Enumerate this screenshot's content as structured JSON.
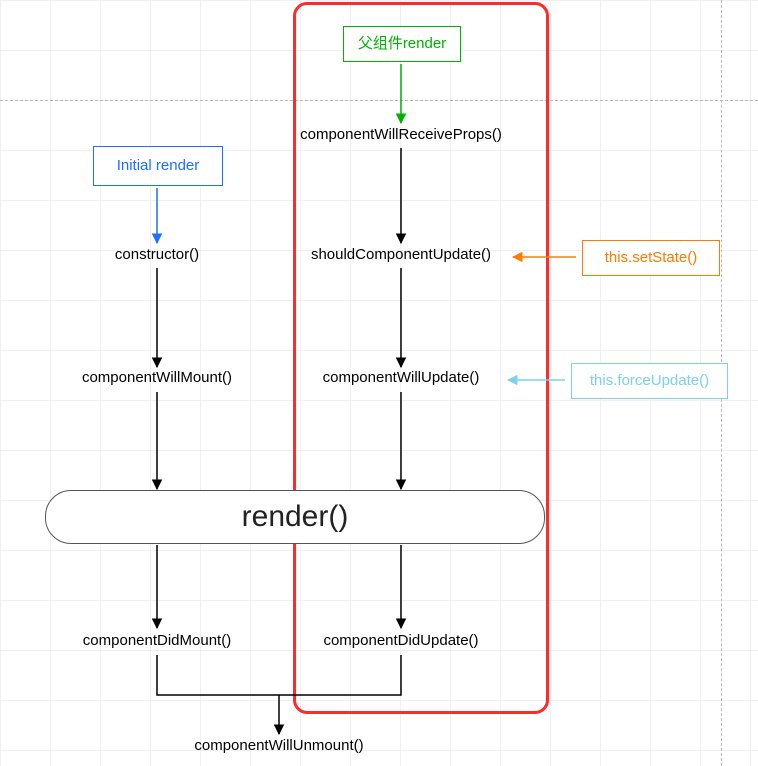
{
  "diagram": {
    "initial_render": "Initial render",
    "parent_render": "父组件render",
    "constructor": "constructor()",
    "component_will_receive_props": "componentWillReceiveProps()",
    "component_will_mount": "componentWillMount()",
    "should_component_update": "shouldComponentUpdate()",
    "component_will_update": "componentWillUpdate()",
    "render": "render()",
    "component_did_mount": "componentDidMount()",
    "component_did_update": "componentDidUpdate()",
    "component_will_unmount": "componentWillUnmount()",
    "this_set_state": "this.setState()",
    "this_force_update": "this.forceUpdate()"
  }
}
